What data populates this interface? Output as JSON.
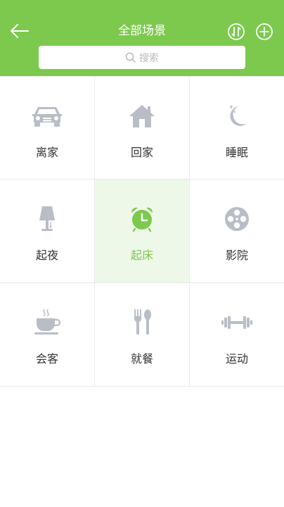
{
  "header": {
    "title": "全部场景",
    "search_placeholder": "搜索",
    "bg_color": "#7dc94e"
  },
  "scenes": [
    {
      "label": "离家",
      "icon": "car-icon",
      "active": false
    },
    {
      "label": "回家",
      "icon": "house-icon",
      "active": false
    },
    {
      "label": "睡眠",
      "icon": "moon-icon",
      "active": false
    },
    {
      "label": "起夜",
      "icon": "lamp-icon",
      "active": false
    },
    {
      "label": "起床",
      "icon": "alarm-clock-icon",
      "active": true
    },
    {
      "label": "影院",
      "icon": "film-reel-icon",
      "active": false
    },
    {
      "label": "会客",
      "icon": "tea-cup-icon",
      "active": false
    },
    {
      "label": "就餐",
      "icon": "fork-spoon-icon",
      "active": false
    },
    {
      "label": "运动",
      "icon": "dumbbell-icon",
      "active": false
    }
  ],
  "colors": {
    "accent": "#7dc94e",
    "icon_gray": "#b8bdc6",
    "label": "#333333"
  }
}
